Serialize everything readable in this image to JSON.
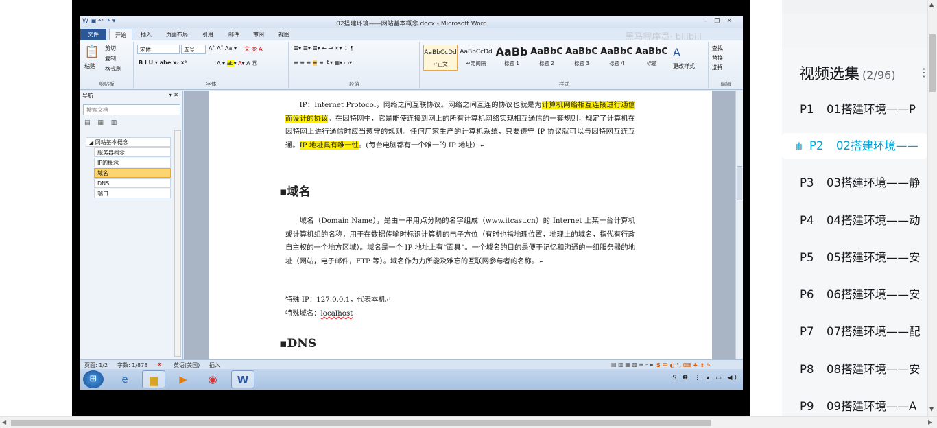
{
  "word": {
    "title": "02搭建环境——网站基本概念.docx - Microsoft Word",
    "watermark": "黑马程序员· bilibili",
    "file_tab": "文件",
    "tabs": [
      "开始",
      "插入",
      "页面布局",
      "引用",
      "邮件",
      "审阅",
      "视图"
    ],
    "clipboard": {
      "paste": "粘贴",
      "cut": "剪切",
      "copy": "复制",
      "format_painter": "格式刷",
      "label": "剪贴板"
    },
    "font": {
      "name": "宋体",
      "size": "五号",
      "label": "字体"
    },
    "paragraph_label": "段落",
    "styles": {
      "label": "样式",
      "items": [
        {
          "sample": "AaBbCcDd",
          "name": "↵正文"
        },
        {
          "sample": "AaBbCcDd",
          "name": "↵无间隔"
        },
        {
          "sample": "AaBb",
          "name": "标题 1"
        },
        {
          "sample": "AaBbC",
          "name": "标题 2"
        },
        {
          "sample": "AaBbC",
          "name": "标题 3"
        },
        {
          "sample": "AaBbC",
          "name": "标题 4"
        },
        {
          "sample": "AaBbC",
          "name": "标题"
        }
      ],
      "change": "更改样式"
    },
    "editing": {
      "find": "查找",
      "replace": "替换",
      "select": "选择",
      "label": "编辑"
    },
    "nav": {
      "header": "导航",
      "search_placeholder": "搜索文档",
      "root": "网站基本概念",
      "children": [
        "服务器概念",
        "IP的概念",
        "域名",
        "DNS",
        "端口"
      ],
      "selected": 2
    },
    "doc": {
      "p1_a": "IP：Internet Protocol，网络之间互联协议。网络之间互连的协议也就是为",
      "p1_hl1": "计算机网络相互连接进行通信而设计的协议",
      "p1_b": "。在因特网中，它是能使连接到网上的所有计算机网络实现相互通信的一套规则，规定了计算机在因特网上进行通信时应当遵守的规则。任何厂家生产的计算机系统，只要遵守 IP 协议就可以与因特网互连互通。",
      "p1_hl2": "IP 地址具有唯一性",
      "p1_c": "。(每台电脑都有一个唯一的 IP 地址）↵",
      "h_domain": "域名",
      "p2": "域名（Domain Name），是由一串用点分隔的名字组成（www.itcast.cn）的 Internet 上某一台计算机或计算机组的名称，用于在数据传输时标识计算机的电子方位（有时也指地理位置，地理上的域名，指代有行政自主权的一个地方区域）。域名是一个 IP 地址上有“面具”。一个域名的目的是便于记忆和沟通的一组服务器的地址（网站，电子邮件，FTP 等）。域名作为力所能及难忘的互联网参与者的名称。↵",
      "special_ip": "特殊 IP：127.0.0.1，代表本机↵",
      "special_domain_label": "特殊域名：",
      "special_domain": "localhost",
      "h_dns": "DNS"
    },
    "status": {
      "page": "页面: 1/2",
      "words": "字数: 1/878",
      "lang": "英语(美国)",
      "mode": "插入"
    }
  },
  "playlist": {
    "title": "视频选集",
    "count": "(2/96)",
    "items": [
      {
        "p": "P1",
        "label": "01搭建环境——P"
      },
      {
        "p": "P2",
        "label": "02搭建环境——"
      },
      {
        "p": "P3",
        "label": "03搭建环境——静"
      },
      {
        "p": "P4",
        "label": "04搭建环境——动"
      },
      {
        "p": "P5",
        "label": "05搭建环境——安"
      },
      {
        "p": "P6",
        "label": "06搭建环境——安"
      },
      {
        "p": "P7",
        "label": "07搭建环境——配"
      },
      {
        "p": "P8",
        "label": "08搭建环境——安"
      },
      {
        "p": "P9",
        "label": "09搭建环境——A"
      }
    ],
    "active_index": 1,
    "accent": "#00a1d6"
  }
}
